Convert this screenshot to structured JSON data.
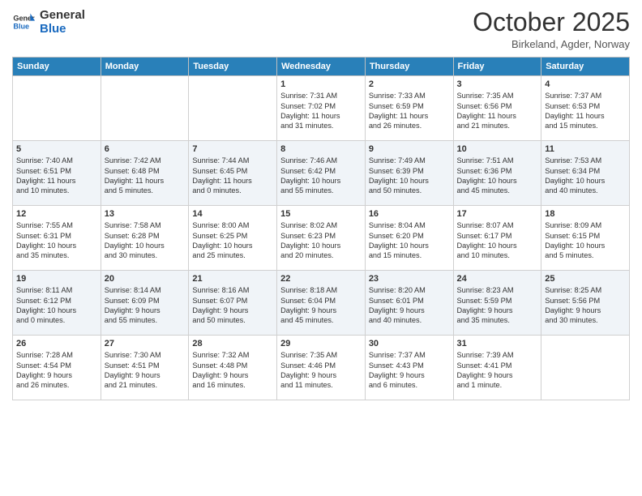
{
  "header": {
    "logo_general": "General",
    "logo_blue": "Blue",
    "month_title": "October 2025",
    "location": "Birkeland, Agder, Norway"
  },
  "weekdays": [
    "Sunday",
    "Monday",
    "Tuesday",
    "Wednesday",
    "Thursday",
    "Friday",
    "Saturday"
  ],
  "weeks": [
    [
      {
        "day": "",
        "info": ""
      },
      {
        "day": "",
        "info": ""
      },
      {
        "day": "",
        "info": ""
      },
      {
        "day": "1",
        "info": "Sunrise: 7:31 AM\nSunset: 7:02 PM\nDaylight: 11 hours\nand 31 minutes."
      },
      {
        "day": "2",
        "info": "Sunrise: 7:33 AM\nSunset: 6:59 PM\nDaylight: 11 hours\nand 26 minutes."
      },
      {
        "day": "3",
        "info": "Sunrise: 7:35 AM\nSunset: 6:56 PM\nDaylight: 11 hours\nand 21 minutes."
      },
      {
        "day": "4",
        "info": "Sunrise: 7:37 AM\nSunset: 6:53 PM\nDaylight: 11 hours\nand 15 minutes."
      }
    ],
    [
      {
        "day": "5",
        "info": "Sunrise: 7:40 AM\nSunset: 6:51 PM\nDaylight: 11 hours\nand 10 minutes."
      },
      {
        "day": "6",
        "info": "Sunrise: 7:42 AM\nSunset: 6:48 PM\nDaylight: 11 hours\nand 5 minutes."
      },
      {
        "day": "7",
        "info": "Sunrise: 7:44 AM\nSunset: 6:45 PM\nDaylight: 11 hours\nand 0 minutes."
      },
      {
        "day": "8",
        "info": "Sunrise: 7:46 AM\nSunset: 6:42 PM\nDaylight: 10 hours\nand 55 minutes."
      },
      {
        "day": "9",
        "info": "Sunrise: 7:49 AM\nSunset: 6:39 PM\nDaylight: 10 hours\nand 50 minutes."
      },
      {
        "day": "10",
        "info": "Sunrise: 7:51 AM\nSunset: 6:36 PM\nDaylight: 10 hours\nand 45 minutes."
      },
      {
        "day": "11",
        "info": "Sunrise: 7:53 AM\nSunset: 6:34 PM\nDaylight: 10 hours\nand 40 minutes."
      }
    ],
    [
      {
        "day": "12",
        "info": "Sunrise: 7:55 AM\nSunset: 6:31 PM\nDaylight: 10 hours\nand 35 minutes."
      },
      {
        "day": "13",
        "info": "Sunrise: 7:58 AM\nSunset: 6:28 PM\nDaylight: 10 hours\nand 30 minutes."
      },
      {
        "day": "14",
        "info": "Sunrise: 8:00 AM\nSunset: 6:25 PM\nDaylight: 10 hours\nand 25 minutes."
      },
      {
        "day": "15",
        "info": "Sunrise: 8:02 AM\nSunset: 6:23 PM\nDaylight: 10 hours\nand 20 minutes."
      },
      {
        "day": "16",
        "info": "Sunrise: 8:04 AM\nSunset: 6:20 PM\nDaylight: 10 hours\nand 15 minutes."
      },
      {
        "day": "17",
        "info": "Sunrise: 8:07 AM\nSunset: 6:17 PM\nDaylight: 10 hours\nand 10 minutes."
      },
      {
        "day": "18",
        "info": "Sunrise: 8:09 AM\nSunset: 6:15 PM\nDaylight: 10 hours\nand 5 minutes."
      }
    ],
    [
      {
        "day": "19",
        "info": "Sunrise: 8:11 AM\nSunset: 6:12 PM\nDaylight: 10 hours\nand 0 minutes."
      },
      {
        "day": "20",
        "info": "Sunrise: 8:14 AM\nSunset: 6:09 PM\nDaylight: 9 hours\nand 55 minutes."
      },
      {
        "day": "21",
        "info": "Sunrise: 8:16 AM\nSunset: 6:07 PM\nDaylight: 9 hours\nand 50 minutes."
      },
      {
        "day": "22",
        "info": "Sunrise: 8:18 AM\nSunset: 6:04 PM\nDaylight: 9 hours\nand 45 minutes."
      },
      {
        "day": "23",
        "info": "Sunrise: 8:20 AM\nSunset: 6:01 PM\nDaylight: 9 hours\nand 40 minutes."
      },
      {
        "day": "24",
        "info": "Sunrise: 8:23 AM\nSunset: 5:59 PM\nDaylight: 9 hours\nand 35 minutes."
      },
      {
        "day": "25",
        "info": "Sunrise: 8:25 AM\nSunset: 5:56 PM\nDaylight: 9 hours\nand 30 minutes."
      }
    ],
    [
      {
        "day": "26",
        "info": "Sunrise: 7:28 AM\nSunset: 4:54 PM\nDaylight: 9 hours\nand 26 minutes."
      },
      {
        "day": "27",
        "info": "Sunrise: 7:30 AM\nSunset: 4:51 PM\nDaylight: 9 hours\nand 21 minutes."
      },
      {
        "day": "28",
        "info": "Sunrise: 7:32 AM\nSunset: 4:48 PM\nDaylight: 9 hours\nand 16 minutes."
      },
      {
        "day": "29",
        "info": "Sunrise: 7:35 AM\nSunset: 4:46 PM\nDaylight: 9 hours\nand 11 minutes."
      },
      {
        "day": "30",
        "info": "Sunrise: 7:37 AM\nSunset: 4:43 PM\nDaylight: 9 hours\nand 6 minutes."
      },
      {
        "day": "31",
        "info": "Sunrise: 7:39 AM\nSunset: 4:41 PM\nDaylight: 9 hours\nand 1 minute."
      },
      {
        "day": "",
        "info": ""
      }
    ]
  ]
}
